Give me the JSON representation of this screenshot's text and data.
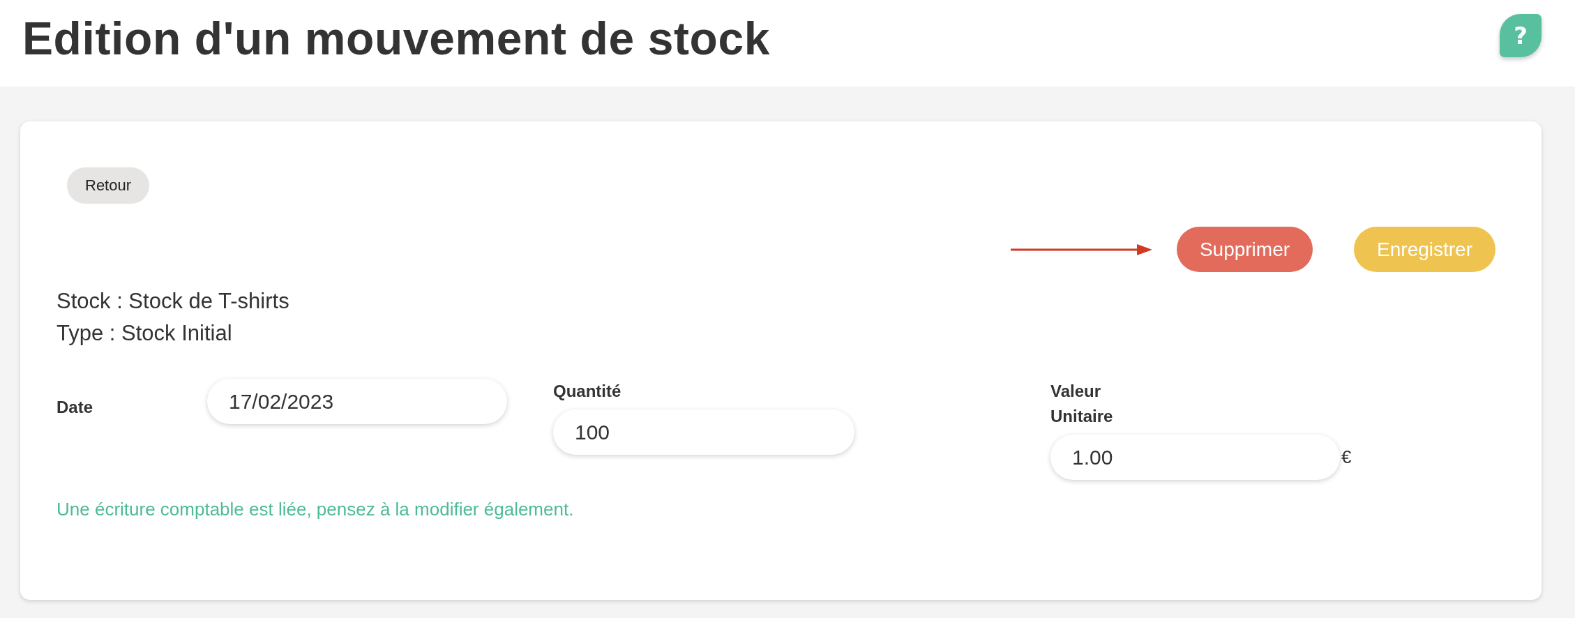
{
  "header": {
    "title": "Edition d'un mouvement de stock",
    "help_button": "?"
  },
  "form": {
    "back_button": "Retour",
    "actions": [
      {
        "label": "Supprimer",
        "kind": "delete",
        "arrow": true
      },
      {
        "label": "Enregistrer",
        "kind": "save",
        "arrow": false
      }
    ],
    "info_lines": [
      "Stock : Stock de T-shirts",
      "Type : Stock Initial"
    ],
    "fields": [
      {
        "kind": "inline",
        "label": "Date",
        "value": "17/02/2023"
      },
      {
        "kind": "stacked",
        "label": "Quantité",
        "value": "100"
      },
      {
        "kind": "stacked",
        "label": "Valeur Unitaire",
        "value": "1.00",
        "unit": "€"
      }
    ],
    "notice": "Une écriture comptable est liée, pensez à la modifier également."
  }
}
